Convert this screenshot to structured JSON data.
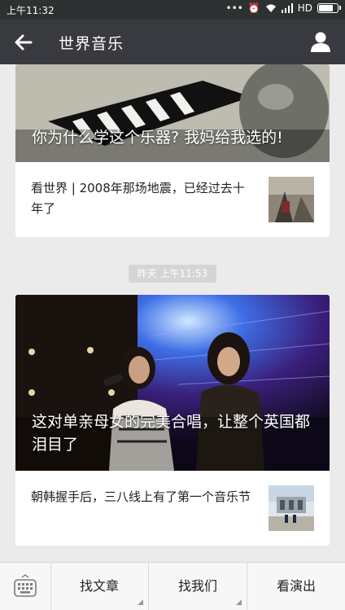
{
  "status": {
    "time": "上午11:32",
    "network": "HD"
  },
  "header": {
    "title": "世界音乐"
  },
  "feed": [
    {
      "cover_title": "你为什么学这个乐器? 我妈给我选的!",
      "sub_title": "看世界 | 2008年那场地震，已经过去十年了"
    },
    {
      "timestamp": "昨天 上午11:53",
      "cover_title": "这对单亲母女的完美合唱，让整个英国都泪目了",
      "sub_title": "朝韩握手后，三八线上有了第一个音乐节"
    }
  ],
  "menu": {
    "items": [
      {
        "label": "找文章"
      },
      {
        "label": "找我们"
      },
      {
        "label": "看演出"
      }
    ]
  }
}
